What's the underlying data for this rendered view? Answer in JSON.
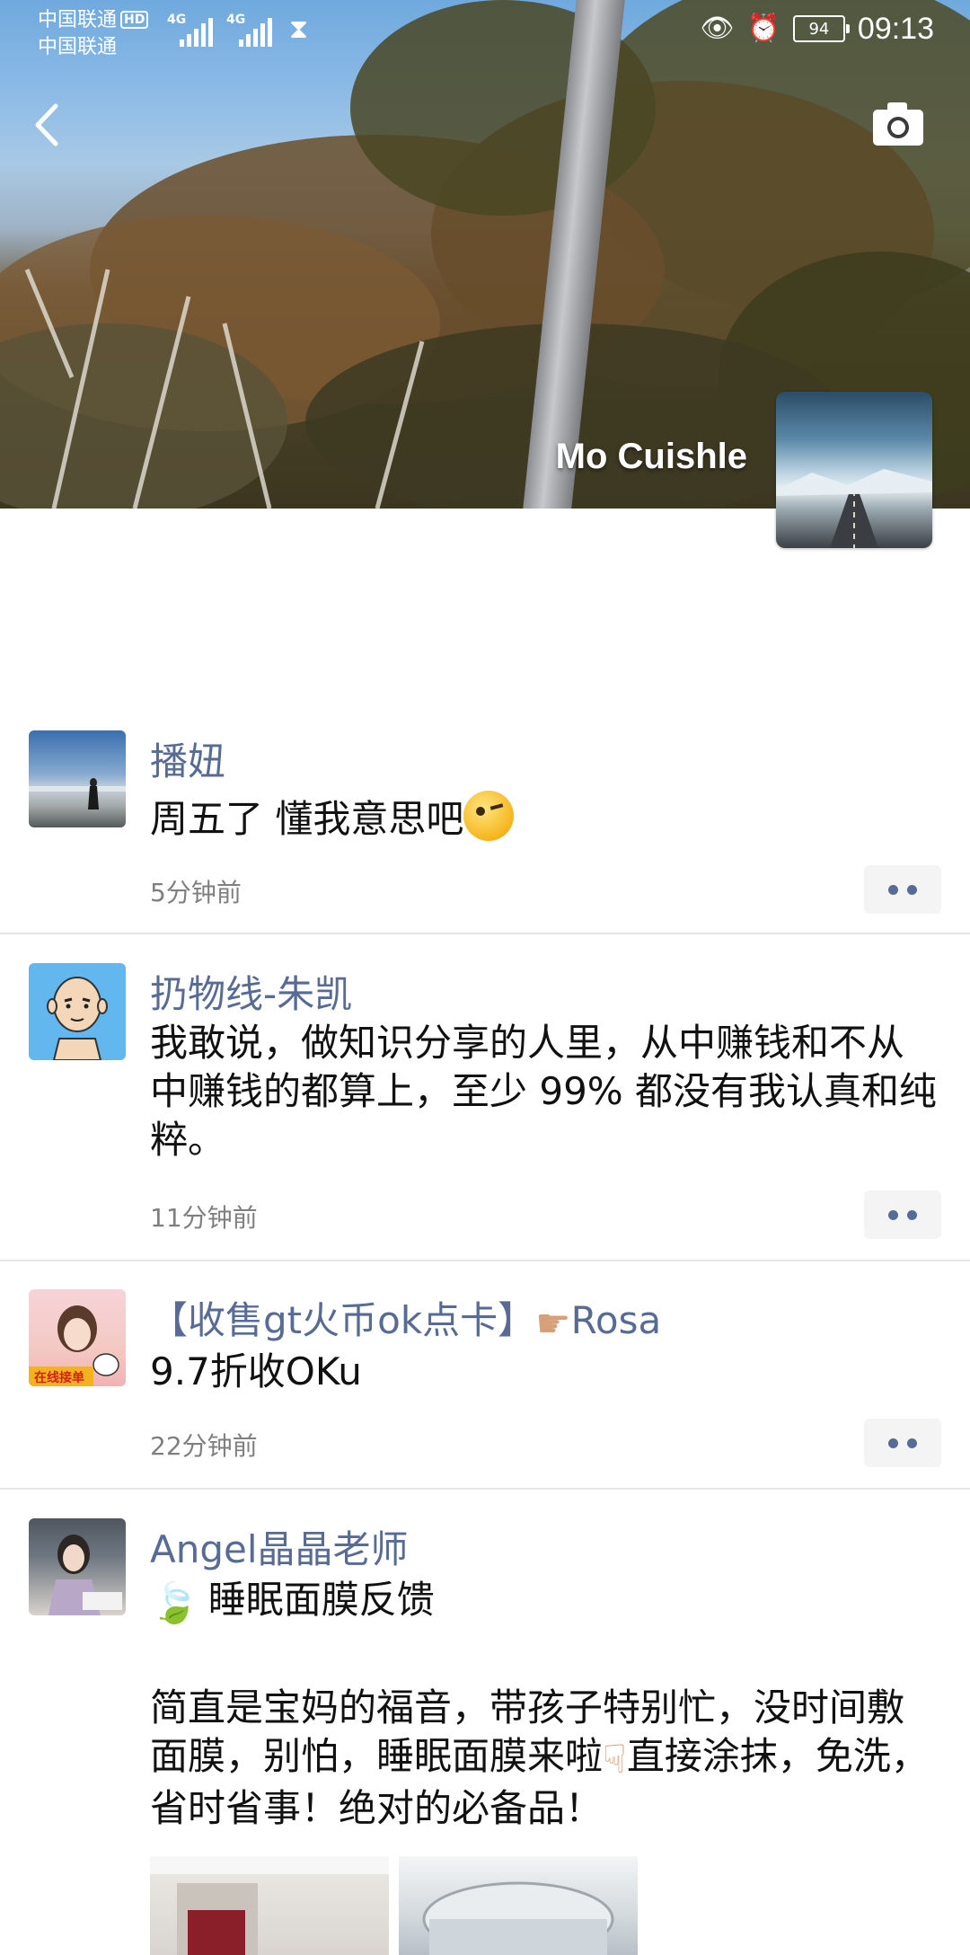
{
  "status_bar": {
    "carrier_1": "中国联通",
    "carrier_2": "中国联通",
    "hd_badge": "HD",
    "network_1": "4G",
    "network_2": "4G",
    "battery": "94",
    "time": "09:13"
  },
  "cover": {
    "profile_name": "Mo Cuishle"
  },
  "posts": [
    {
      "author": "播妞",
      "text": "周五了 懂我意思吧",
      "time": "5分钟前"
    },
    {
      "author": "扔物线-朱凯",
      "text": "我敢说，做知识分享的人里，从中赚钱和不从中赚钱的都算上，至少 99% 都没有我认真和纯粹。",
      "time": "11分钟前"
    },
    {
      "author_prefix": "【收售gt火币ok点卡】",
      "author_suffix": "Rosa",
      "avatar_badge": "在线接单",
      "text": "9.7折收OKu",
      "time": "22分钟前"
    },
    {
      "author": "Angel晶晶老师",
      "title": "睡眠面膜反馈",
      "text_1": "简直是宝妈的福音，带孩子特别忙，没时间敷面膜，别怕，睡眠面膜来啦",
      "text_2": "直接涂抹，免洗，省时省事！绝对的必备品！"
    }
  ]
}
